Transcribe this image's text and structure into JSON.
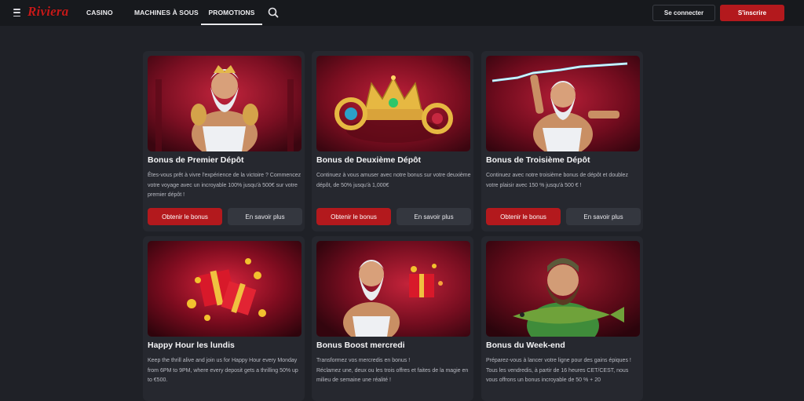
{
  "header": {
    "logo": "Riviera",
    "nav": [
      {
        "label": "CASINO"
      },
      {
        "label": "MACHINES À SOUS"
      },
      {
        "label": "PROMOTIONS",
        "active": true
      }
    ],
    "login_label": "Se connecter",
    "signup_label": "S'inscrire",
    "icons": {
      "menu": "hamburger-menu-icon",
      "search": "search-icon"
    }
  },
  "colors": {
    "background": "#1f2127",
    "header": "#17191d",
    "card": "#26282f",
    "accent_red": "#b3191d",
    "secondary_button": "#34373f"
  },
  "promotions": [
    {
      "title": "Bonus de Premier Dépôt",
      "description": [
        "Êtes-vous prêt à vivre l'expérience de la victoire ? Commencez votre voyage avec un incroyable 100% jusqu'à 500€ sur votre premier dépôt !"
      ],
      "claim_label": "Obtenir le bonus",
      "more_label": "En savoir plus",
      "image": "zeus-character"
    },
    {
      "title": "Bonus de Deuxième Dépôt",
      "description": [
        "Continuez à vous amuser avec notre bonus sur votre deuxième dépôt, de 50% jusqu'à 1,000€"
      ],
      "claim_label": "Obtenir le bonus",
      "more_label": "En savoir plus",
      "image": "golden-crown-with-rings"
    },
    {
      "title": "Bonus de Troisième Dépôt",
      "description": [
        "Continuez avec notre troisième bonus de dépôt et doublez votre plaisir avec 150 % jusqu'à 500 € !"
      ],
      "claim_label": "Obtenir le bonus",
      "more_label": "En savoir plus",
      "image": "zeus-with-lightning"
    },
    {
      "title": "Happy Hour les lundis",
      "description": [
        "Keep the thrill alive and join us for Happy Hour every Monday from 6PM to 9PM, where every deposit gets a thrilling 50% up to €500."
      ],
      "image": "gift-boxes-and-coins"
    },
    {
      "title": "Bonus Boost mercredi",
      "description": [
        "Transformez vos mercredis en bonus !",
        "Réclamez une, deux ou les trois offres et faites de la magie en milieu de semaine une réalité !"
      ],
      "image": "zeus-with-gift"
    },
    {
      "title": "Bonus du Week-end",
      "description": [
        "Préparez-vous à lancer votre ligne pour des gains épiques !",
        "Tous les vendredis, à partir de 16 heures CET/CEST, nous vous offrons un bonus incroyable de 50 % + 20"
      ],
      "image": "fisherman-with-fish"
    }
  ]
}
